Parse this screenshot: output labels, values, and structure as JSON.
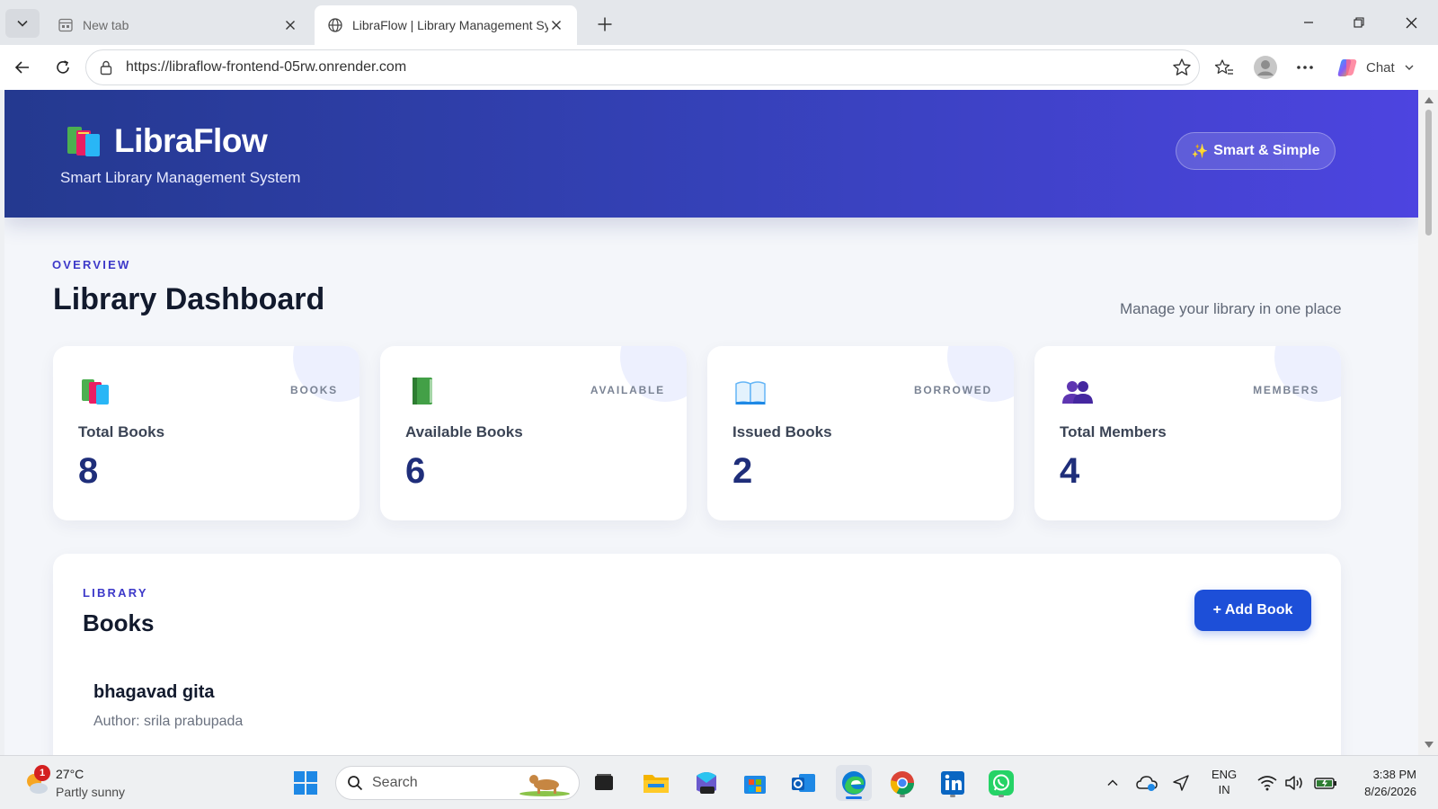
{
  "browser": {
    "tabs": [
      {
        "title": "New tab",
        "active": false
      },
      {
        "title": "LibraFlow | Library Management Sy",
        "active": true
      }
    ],
    "url": "https://libraflow-frontend-05rw.onrender.com",
    "chat_label": "Chat"
  },
  "header": {
    "brand": "LibraFlow",
    "tagline": "Smart Library Management System",
    "badge": "Smart & Simple"
  },
  "overview": {
    "eyebrow": "OVERVIEW",
    "title": "Library Dashboard",
    "subtitle": "Manage your library in one place",
    "cards": [
      {
        "tag": "BOOKS",
        "label": "Total Books",
        "value": "8",
        "icon": "books-stack-icon"
      },
      {
        "tag": "AVAILABLE",
        "label": "Available Books",
        "value": "6",
        "icon": "green-book-icon"
      },
      {
        "tag": "BORROWED",
        "label": "Issued Books",
        "value": "2",
        "icon": "open-book-icon"
      },
      {
        "tag": "MEMBERS",
        "label": "Total Members",
        "value": "4",
        "icon": "members-icon"
      }
    ]
  },
  "library": {
    "eyebrow": "LIBRARY",
    "title": "Books",
    "add_button": "+ Add Book",
    "books": [
      {
        "title": "bhagavad gita",
        "author": "Author: srila prabupada"
      }
    ]
  },
  "taskbar": {
    "weather_temp": "27°C",
    "weather_cond": "Partly sunny",
    "weather_badge": "1",
    "search_label": "Search",
    "lang_line1": "ENG",
    "lang_line2": "IN",
    "time": "3:38 PM",
    "date": "8/26/2026"
  },
  "colors": {
    "accent": "#3d39c9",
    "hero_start": "#24398f",
    "hero_end": "#4d44e0",
    "button": "#1d4fd8",
    "stat_value": "#1f2e7a"
  }
}
